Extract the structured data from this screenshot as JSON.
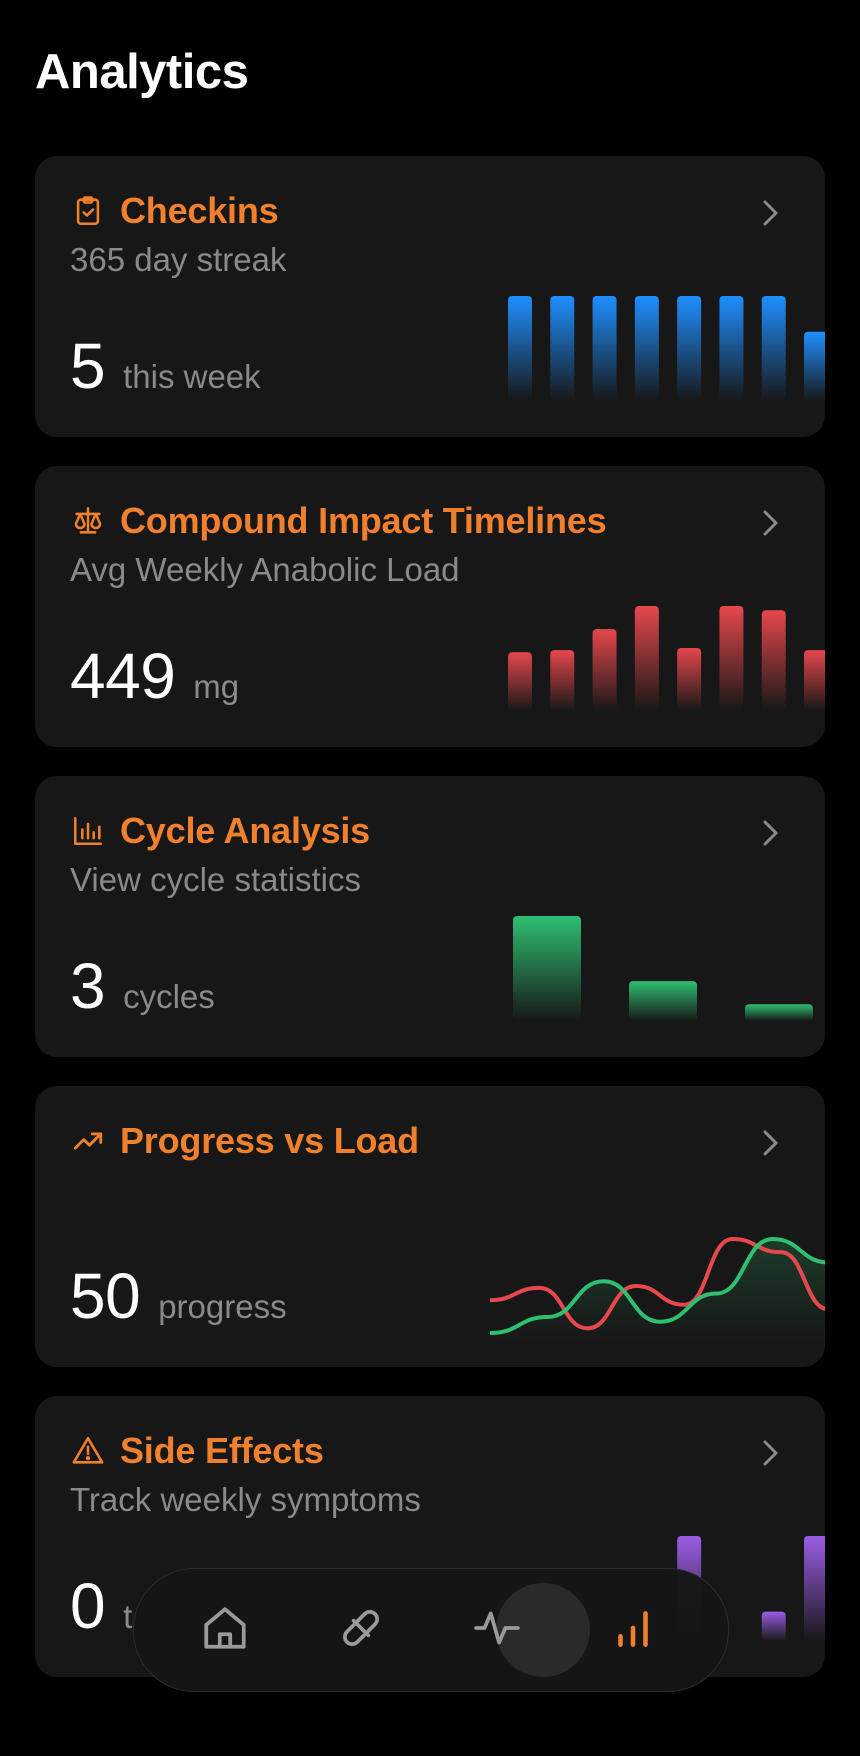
{
  "page": {
    "title": "Analytics"
  },
  "colors": {
    "accent": "#F0802E",
    "blue": "#1F8FFF",
    "red": "#E5484D",
    "green": "#2FBF71",
    "purple": "#9B5DE5"
  },
  "cards": [
    {
      "id": "checkins",
      "icon": "clipboard-check-icon",
      "title": "Checkins",
      "subtitle": "365 day streak",
      "value": "5",
      "unit": "this week",
      "chart": {
        "type": "bar",
        "color": "#1F8FFF",
        "values": [
          1,
          1,
          1,
          1,
          1,
          1,
          1,
          0.66
        ]
      }
    },
    {
      "id": "compound-impact",
      "icon": "scale-icon",
      "title": "Compound Impact Timelines",
      "subtitle": "Avg Weekly Anabolic Load",
      "value": "449",
      "unit": "mg",
      "chart": {
        "type": "bar",
        "color": "#E5484D",
        "values": [
          0.56,
          0.58,
          0.78,
          1,
          0.6,
          1,
          0.96,
          0.58
        ]
      }
    },
    {
      "id": "cycle-analysis",
      "icon": "bar-chart-icon",
      "title": "Cycle Analysis",
      "subtitle": "View cycle statistics",
      "value": "3",
      "unit": "cycles",
      "chart": {
        "type": "bar",
        "color": "#2FBF71",
        "values": [
          1,
          0.38,
          0.16
        ]
      }
    },
    {
      "id": "progress-vs-load",
      "icon": "trending-up-icon",
      "title": "Progress vs Load",
      "subtitle": "",
      "value": "50",
      "unit": "progress",
      "chart": {
        "type": "line",
        "series": [
          {
            "color": "#E5484D",
            "values": [
              0.35,
              0.48,
              0.05,
              0.5,
              0.3,
              1.0,
              0.86,
              0.25
            ]
          },
          {
            "color": "#2FBF71",
            "values": [
              0.0,
              0.17,
              0.55,
              0.12,
              0.42,
              1.0,
              0.75
            ]
          }
        ]
      }
    },
    {
      "id": "side-effects",
      "icon": "warning-triangle-icon",
      "title": "Side Effects",
      "subtitle": "Track weekly symptoms",
      "value": "0",
      "unit": "t",
      "chart": {
        "type": "bar",
        "color": "#9B5DE5",
        "values": [
          0,
          0,
          0,
          0,
          1,
          0,
          0.28,
          1
        ]
      }
    }
  ],
  "navbar": {
    "items": [
      {
        "name": "nav-home",
        "icon": "home-icon",
        "active": false
      },
      {
        "name": "nav-compounds",
        "icon": "pill-icon",
        "active": false
      },
      {
        "name": "nav-activity",
        "icon": "pulse-icon",
        "active": false
      },
      {
        "name": "nav-analytics",
        "icon": "signal-bars-icon",
        "active": true
      }
    ]
  }
}
